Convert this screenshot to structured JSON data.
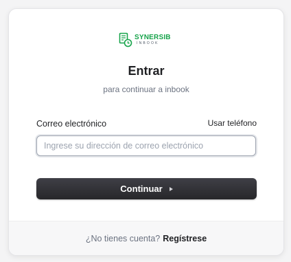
{
  "brand": {
    "name": "SYNERSIB",
    "sub": "INBOOK",
    "color": "#16a34a",
    "icon": "document-clock-icon"
  },
  "header": {
    "title": "Entrar",
    "subtitle": "para continuar a inbook"
  },
  "form": {
    "email_label": "Correo electrónico",
    "alt_method_label": "Usar teléfono",
    "email_placeholder": "Ingrese su dirección de correo electrónico",
    "email_value": "",
    "submit_label": "Continuar"
  },
  "footer": {
    "prompt": "¿No tienes cuenta?",
    "signup_label": "Regístrese"
  },
  "colors": {
    "button": "#2f2f33",
    "background": "#f4f4f5",
    "card": "#ffffff"
  }
}
